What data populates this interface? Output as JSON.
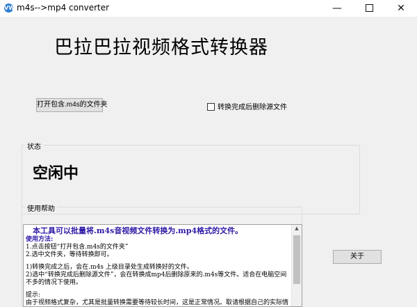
{
  "window": {
    "title": "m4s-->mp4 converter",
    "icon_label": "VW",
    "minimize": "—",
    "close": "✕"
  },
  "heading": "巴拉巴拉视频格式转换器",
  "open_button": "打开包含.m4s的文件夹",
  "delete_option": {
    "label": "转换完成后删除源文件",
    "checked": false
  },
  "status": {
    "legend": "状态",
    "text": "空闲中"
  },
  "help": {
    "legend": "使用帮助",
    "intro": "本工具可以批量将.m4s音视频文件转换为.mp4格式的文件。",
    "usage_title": "使用方法:",
    "usage_lines": [
      "1.点击按钮“打开包含.m4s的文件夹”",
      "2.选中文件夹，等待转换即可。"
    ],
    "note_lines": [
      "1)转换完成之后，会在.m4s 上级目录处生成转换好的文件。",
      "2)选中“转换完成后删除源文件”，会在转换成mp4后删除原来的.m4s等文件。适合在电脑空间不多的情况下使用。"
    ],
    "tips_title": "提示:",
    "tips_line": "由于视频格式复杂，尤其是批量转换需要等待较长时间，这是正常情况。取请根据自己的实际情"
  },
  "about_button": "关于"
}
